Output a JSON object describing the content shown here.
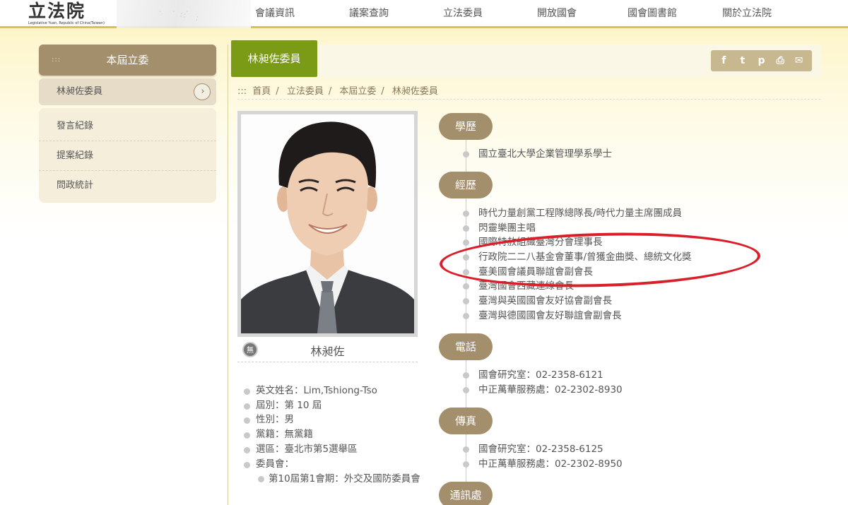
{
  "header": {
    "logo_text": "立法院",
    "logo_subtext": "Legislative Yuan, Republic of China(Taiwan)",
    "nav": [
      {
        "label": "會議資訊"
      },
      {
        "label": "議案查詢"
      },
      {
        "label": "立法委員"
      },
      {
        "label": "開放國會"
      },
      {
        "label": "國會圖書館"
      },
      {
        "label": "關於立法院"
      }
    ]
  },
  "sidebar": {
    "title": "本屆立委",
    "title_dots": ":::",
    "active_item": "林昶佐委員",
    "items": [
      {
        "label": "發言紀錄"
      },
      {
        "label": "提案紀錄"
      },
      {
        "label": "問政統計"
      }
    ]
  },
  "main": {
    "tab_title": "林昶佐委員",
    "share_icons": [
      "facebook-icon",
      "twitter-icon",
      "plurk-icon",
      "print-icon",
      "mail-icon"
    ],
    "share_glyphs": [
      "f",
      "t",
      "p",
      "⎙",
      "✉"
    ],
    "breadcrumb_prefix": ":::",
    "breadcrumb": [
      "首頁",
      "立法委員",
      "本屆立委",
      "林昶佐委員"
    ],
    "breadcrumb_sep": "/"
  },
  "profile": {
    "party_badge": "無",
    "name": "林昶佐",
    "info": [
      "英文姓名：Lim,Tshiong-Tso",
      "屆別：第 10 屆",
      "性別：男",
      "黨籍：無黨籍",
      "選區：臺北市第5選舉區",
      "委員會："
    ],
    "committee": [
      "第10屆第1會期：外交及國防委員會"
    ]
  },
  "sections": {
    "education": {
      "title": "學歷",
      "items": [
        "國立臺北大學企業管理學系學士"
      ]
    },
    "experience": {
      "title": "經歷",
      "items": [
        "時代力量創黨工程隊總隊長/時代力量主席團成員",
        "閃靈樂團主唱",
        "國際特赦組織臺灣分會理事長",
        "行政院二二八基金會董事/曾獲金曲獎、總統文化獎",
        "臺美國會議員聯誼會副會長",
        "臺灣國會西藏連線會長",
        "臺灣與英國國會友好協會副會長",
        "臺灣與德國國會友好聯誼會副會長"
      ]
    },
    "phone": {
      "title": "電話",
      "items": [
        "國會研究室：02-2358-6121",
        "中正萬華服務處：02-2302-8930"
      ]
    },
    "fax": {
      "title": "傳真",
      "items": [
        "國會研究室：02-2358-6125",
        "中正萬華服務處：02-2302-8950"
      ]
    },
    "address": {
      "title": "通訊處"
    }
  }
}
